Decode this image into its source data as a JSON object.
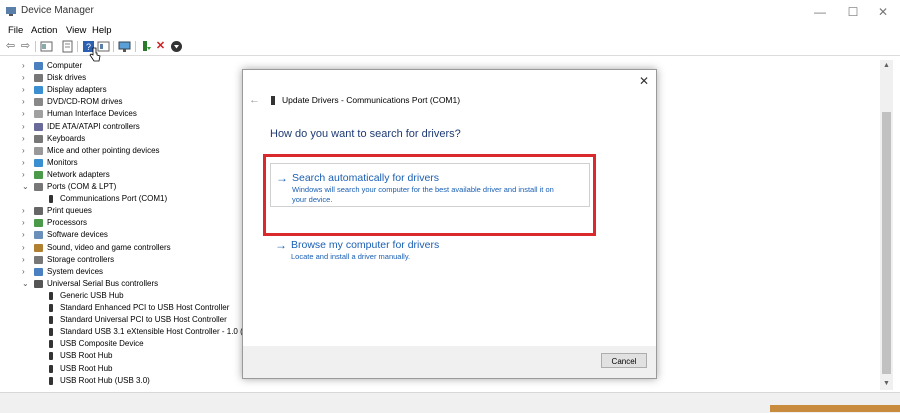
{
  "window": {
    "title": "Device Manager"
  },
  "menu": [
    "File",
    "Action",
    "View",
    "Help"
  ],
  "toolbar_icons": [
    "back-arrow-icon",
    "forward-arrow-icon",
    "properties-icon",
    "update-driver-icon",
    "help-icon",
    "view-icon",
    "monitor-icon",
    "enable-device-icon",
    "uninstall-icon",
    "download-icon"
  ],
  "tree": [
    {
      "label": "Computer",
      "expanded": false,
      "child": false
    },
    {
      "label": "Disk drives",
      "expanded": false,
      "child": false
    },
    {
      "label": "Display adapters",
      "expanded": false,
      "child": false
    },
    {
      "label": "DVD/CD-ROM drives",
      "expanded": false,
      "child": false
    },
    {
      "label": "Human Interface Devices",
      "expanded": false,
      "child": false
    },
    {
      "label": "IDE ATA/ATAPI controllers",
      "expanded": false,
      "child": false
    },
    {
      "label": "Keyboards",
      "expanded": false,
      "child": false
    },
    {
      "label": "Mice and other pointing devices",
      "expanded": false,
      "child": false
    },
    {
      "label": "Monitors",
      "expanded": false,
      "child": false
    },
    {
      "label": "Network adapters",
      "expanded": false,
      "child": false
    },
    {
      "label": "Ports (COM & LPT)",
      "expanded": true,
      "child": false
    },
    {
      "label": "Communications Port (COM1)",
      "expanded": false,
      "child": true
    },
    {
      "label": "Print queues",
      "expanded": false,
      "child": false
    },
    {
      "label": "Processors",
      "expanded": false,
      "child": false
    },
    {
      "label": "Software devices",
      "expanded": false,
      "child": false
    },
    {
      "label": "Sound, video and game controllers",
      "expanded": false,
      "child": false
    },
    {
      "label": "Storage controllers",
      "expanded": false,
      "child": false
    },
    {
      "label": "System devices",
      "expanded": false,
      "child": false
    },
    {
      "label": "Universal Serial Bus controllers",
      "expanded": true,
      "child": false
    },
    {
      "label": "Generic USB Hub",
      "expanded": false,
      "child": true
    },
    {
      "label": "Standard Enhanced PCI to USB Host Controller",
      "expanded": false,
      "child": true
    },
    {
      "label": "Standard Universal PCI to USB Host Controller",
      "expanded": false,
      "child": true
    },
    {
      "label": "Standard USB 3.1 eXtensible Host Controller - 1.0 (M",
      "expanded": false,
      "child": true
    },
    {
      "label": "USB Composite Device",
      "expanded": false,
      "child": true
    },
    {
      "label": "USB Root Hub",
      "expanded": false,
      "child": true
    },
    {
      "label": "USB Root Hub",
      "expanded": false,
      "child": true
    },
    {
      "label": "USB Root Hub (USB 3.0)",
      "expanded": false,
      "child": true
    }
  ],
  "dialog": {
    "header": "Update Drivers - Communications Port (COM1)",
    "question": "How do you want to search for drivers?",
    "option_auto": {
      "title": "Search automatically for drivers",
      "desc_line1": "Windows will search your computer for the best available driver and install it on",
      "desc_line2": "your device."
    },
    "option_browse": {
      "title": "Browse my computer for drivers",
      "desc": "Locate and install a driver manually."
    },
    "cancel": "Cancel"
  },
  "colors": {
    "link_blue": "#1a5fb4",
    "highlight_red": "#d9292c"
  }
}
